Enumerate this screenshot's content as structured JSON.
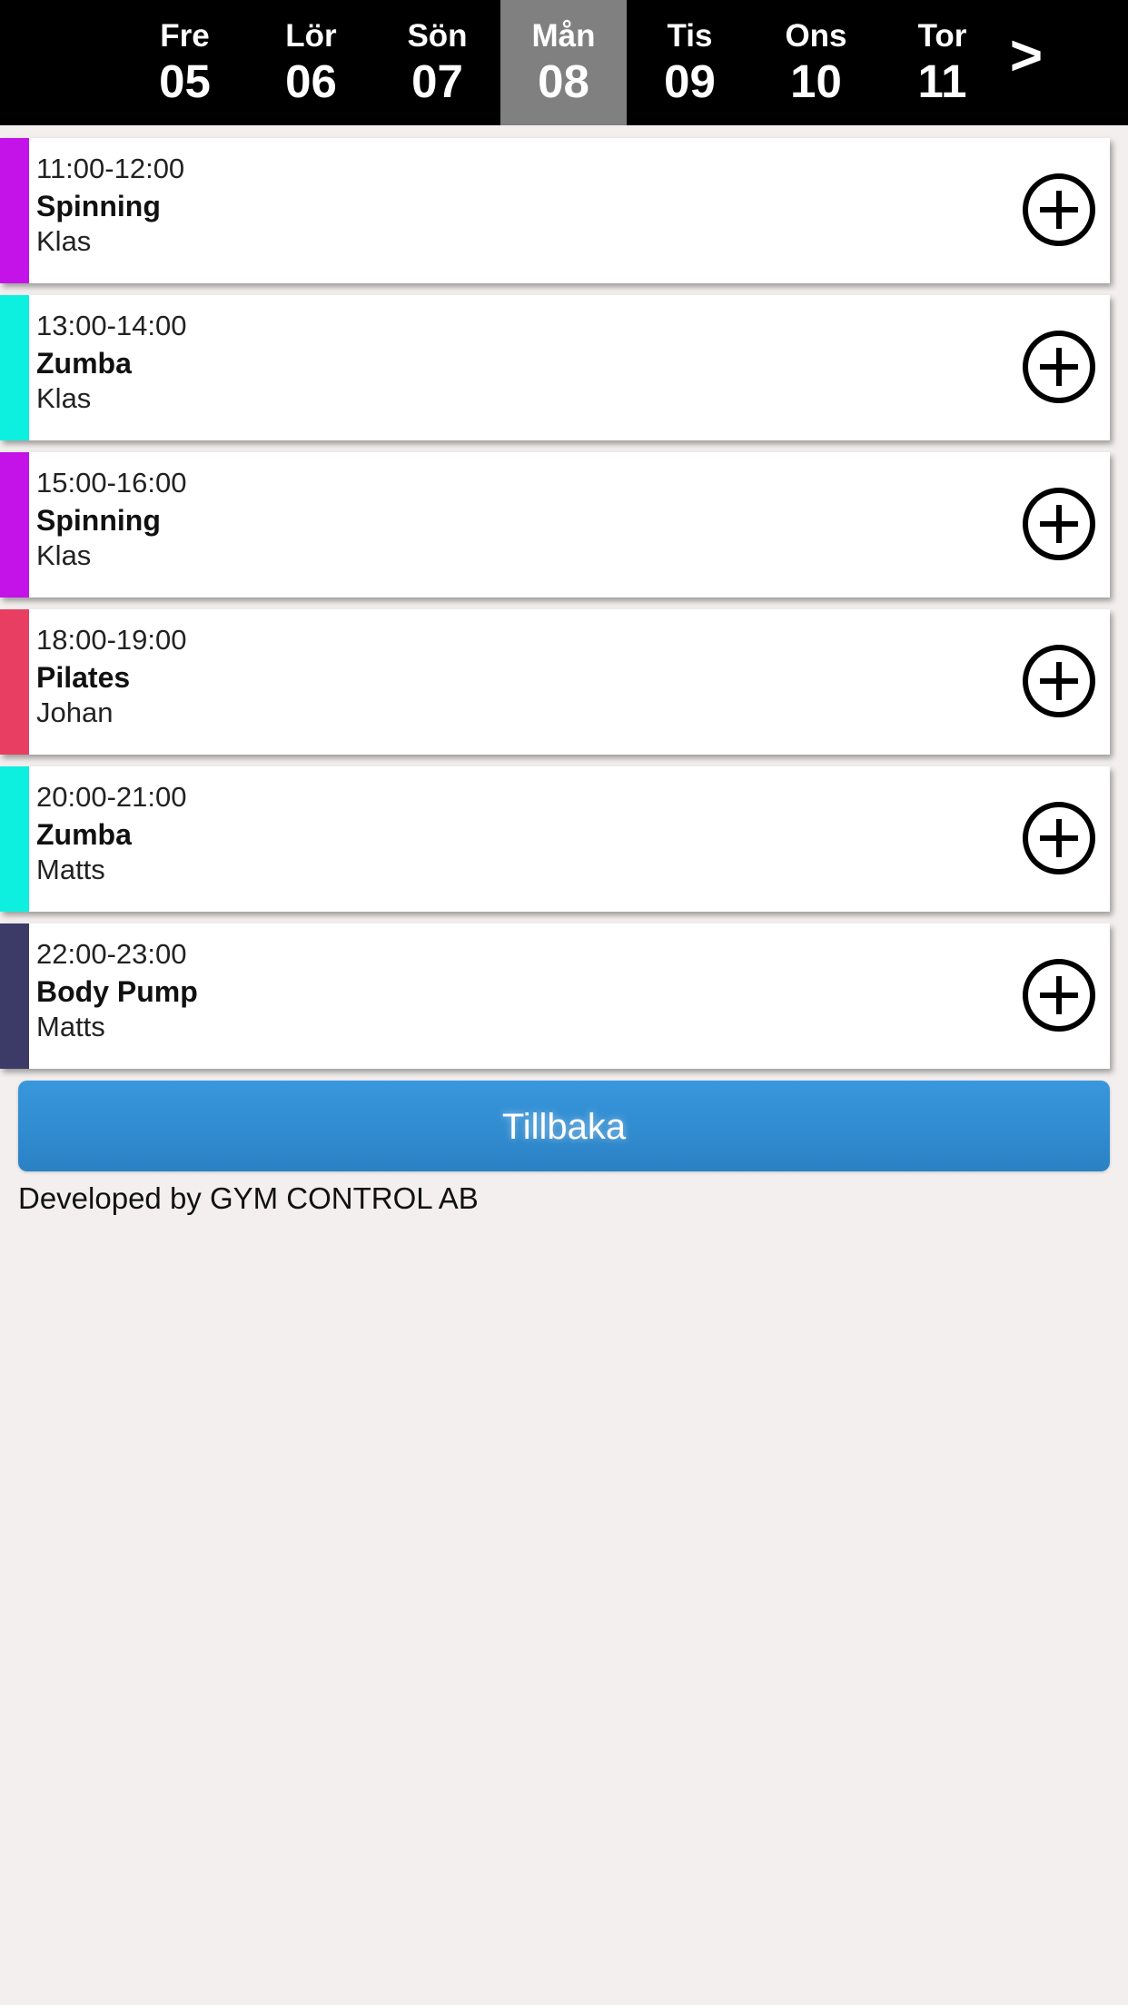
{
  "header": {
    "days": [
      {
        "name": "Fre",
        "num": "05",
        "active": false
      },
      {
        "name": "Lör",
        "num": "06",
        "active": false
      },
      {
        "name": "Sön",
        "num": "07",
        "active": false
      },
      {
        "name": "Mån",
        "num": "08",
        "active": true
      },
      {
        "name": "Tis",
        "num": "09",
        "active": false
      },
      {
        "name": "Ons",
        "num": "10",
        "active": false
      },
      {
        "name": "Tor",
        "num": "11",
        "active": false
      }
    ],
    "next_label": ">",
    "active_color": "#808080"
  },
  "classes": [
    {
      "time": "11:00-12:00",
      "title": "Spinning",
      "coach": "Klas",
      "color": "#c313e8",
      "icon": "plus-circle-icon"
    },
    {
      "time": "13:00-14:00",
      "title": "Zumba",
      "coach": "Klas",
      "color": "#0df0e0",
      "icon": "plus-circle-icon"
    },
    {
      "time": "15:00-16:00",
      "title": "Spinning",
      "coach": "Klas",
      "color": "#c313e8",
      "icon": "plus-circle-icon"
    },
    {
      "time": "18:00-19:00",
      "title": "Pilates",
      "coach": "Johan",
      "color": "#e83e62",
      "icon": "plus-circle-icon"
    },
    {
      "time": "20:00-21:00",
      "title": "Zumba",
      "coach": "Matts",
      "color": "#0df0e0",
      "icon": "plus-circle-icon"
    },
    {
      "time": "22:00-23:00",
      "title": "Body Pump",
      "coach": "Matts",
      "color": "#3c3a66",
      "icon": "plus-circle-icon"
    }
  ],
  "back_button": {
    "label": "Tillbaka",
    "color": "#3190d4"
  },
  "footer": {
    "text": "Developed by GYM CONTROL AB"
  }
}
